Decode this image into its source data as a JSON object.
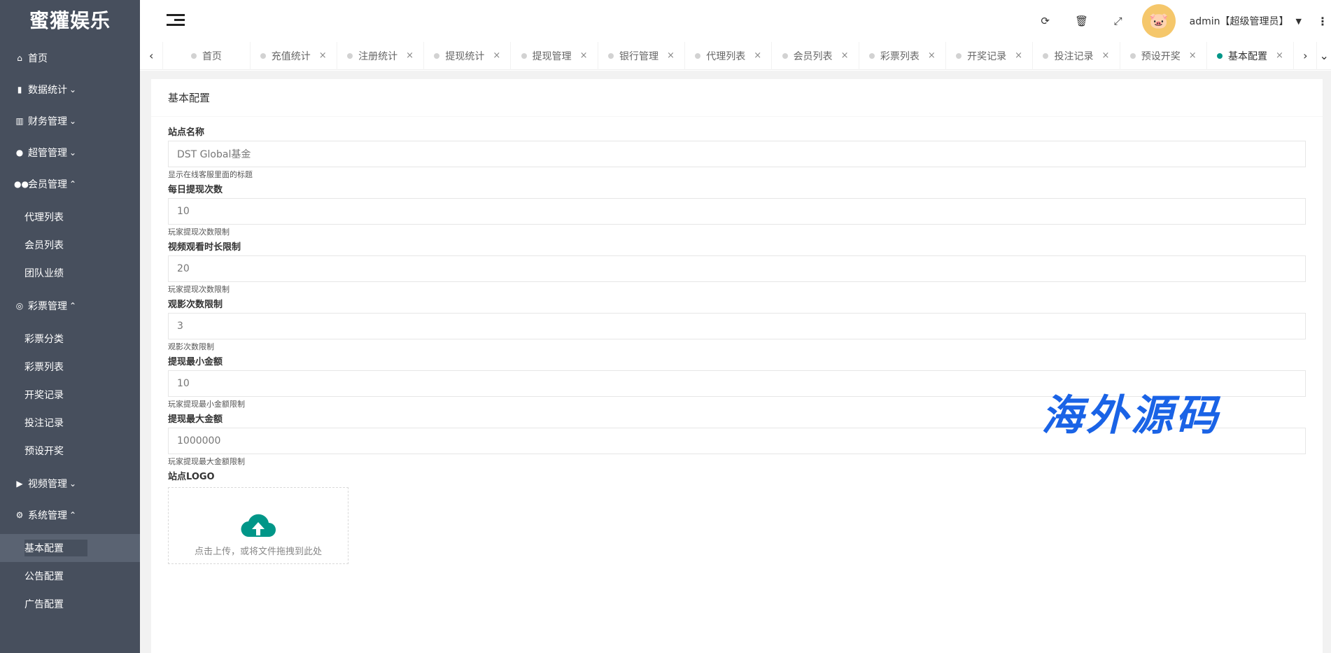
{
  "brand": "蜜獾娱乐",
  "sidebar": {
    "home": "首页",
    "groups": [
      {
        "label": "数据统计",
        "icon": "bar-chart-icon",
        "expanded": false
      },
      {
        "label": "财务管理",
        "icon": "bank-icon",
        "expanded": false
      },
      {
        "label": "超管管理",
        "icon": "user-icon",
        "expanded": false
      },
      {
        "label": "会员管理",
        "icon": "users-icon",
        "expanded": true,
        "children": [
          "代理列表",
          "会员列表",
          "团队业绩"
        ]
      },
      {
        "label": "彩票管理",
        "icon": "gamepad-icon",
        "expanded": true,
        "children": [
          "彩票分类",
          "彩票列表",
          "开奖记录",
          "投注记录",
          "预设开奖"
        ]
      },
      {
        "label": "视频管理",
        "icon": "video-icon",
        "expanded": false
      },
      {
        "label": "系统管理",
        "icon": "gear-icon",
        "expanded": true,
        "children": [
          "基本配置",
          "公告配置",
          "广告配置"
        ]
      }
    ],
    "active": "基本配置"
  },
  "header": {
    "user": "admin【超级管理员】"
  },
  "tabs": [
    {
      "label": "首页",
      "closable": false
    },
    {
      "label": "充值统计",
      "closable": true
    },
    {
      "label": "注册统计",
      "closable": true
    },
    {
      "label": "提现统计",
      "closable": true
    },
    {
      "label": "提现管理",
      "closable": true
    },
    {
      "label": "银行管理",
      "closable": true
    },
    {
      "label": "代理列表",
      "closable": true
    },
    {
      "label": "会员列表",
      "closable": true
    },
    {
      "label": "彩票列表",
      "closable": true
    },
    {
      "label": "开奖记录",
      "closable": true
    },
    {
      "label": "投注记录",
      "closable": true
    },
    {
      "label": "预设开奖",
      "closable": true
    },
    {
      "label": "基本配置",
      "closable": true,
      "active": true
    }
  ],
  "page": {
    "title": "基本配置",
    "fields": [
      {
        "label": "站点名称",
        "value": "DST Global基金",
        "hint": "显示在线客服里面的标题"
      },
      {
        "label": "每日提现次数",
        "value": "10",
        "hint": "玩家提现次数限制"
      },
      {
        "label": "视频观看时长限制",
        "value": "20",
        "hint": "玩家提现次数限制"
      },
      {
        "label": "观影次数限制",
        "value": "3",
        "hint": "观影次数限制"
      },
      {
        "label": "提现最小金额",
        "value": "10",
        "hint": "玩家提现最小金额限制"
      },
      {
        "label": "提现最大金额",
        "value": "1000000",
        "hint": "玩家提现最大金额限制"
      }
    ],
    "logo_label": "站点LOGO",
    "upload_text": "点击上传，或将文件拖拽到此处"
  },
  "watermark": "海外源码",
  "colors": {
    "sidebar_bg": "#474f5d",
    "accent": "#009688",
    "watermark": "#1a63e6"
  }
}
